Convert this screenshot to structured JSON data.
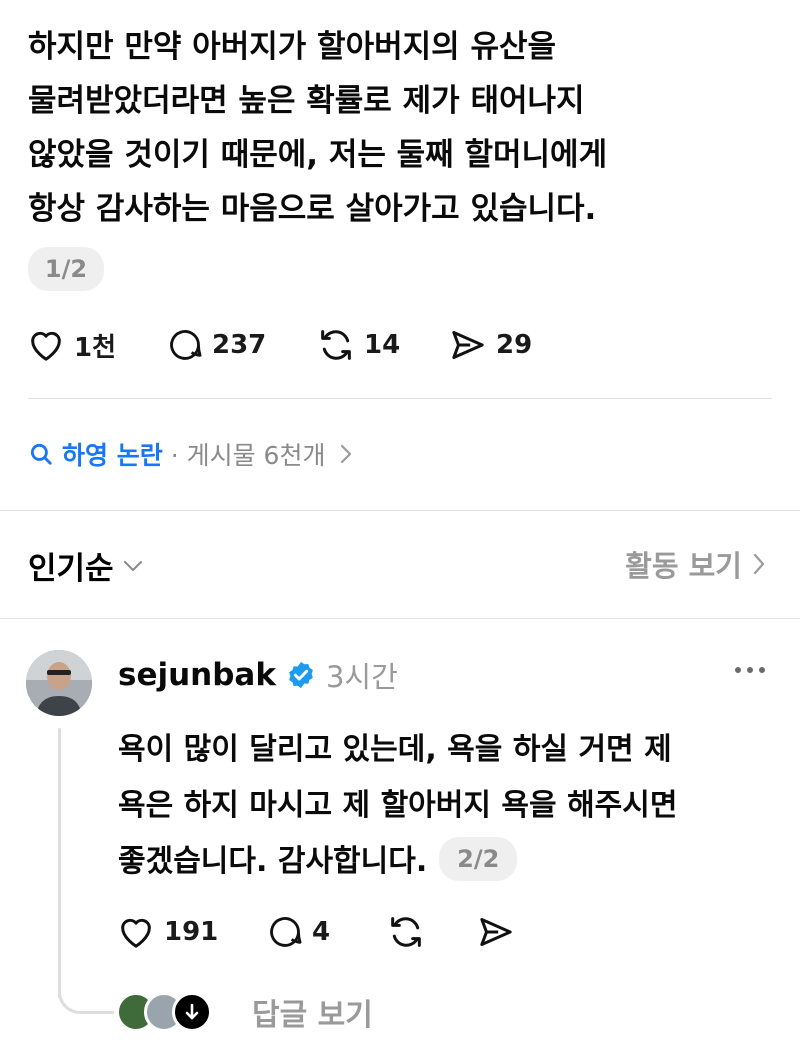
{
  "post": {
    "lines": [
      "하지만 만약 아버지가 할아버지의 유산을",
      "물려받았더라면 높은 확률로 제가 태어나지",
      "않았을 것이기 때문에, 저는 둘째 할머니에게",
      "항상 감사하는 마음으로 살아가고 있습니다."
    ],
    "pager": "1/2",
    "actions": {
      "likes": "1천",
      "replies": "237",
      "reposts": "14",
      "shares": "29"
    }
  },
  "topic": {
    "name": "하영 논란",
    "count": "· 게시물 6천개"
  },
  "sort": {
    "label": "인기순"
  },
  "activity": {
    "label": "활동 보기"
  },
  "reply": {
    "username": "sejunbak",
    "time": "3시간",
    "lines": [
      "욕이 많이 달리고 있는데, 욕을 하실 거면 제",
      "욕은 하지 마시고 제 할아버지 욕을 해주시면",
      "좋겠습니다. 감사합니다."
    ],
    "pager": "2/2",
    "actions": {
      "likes": "191",
      "replies": "4"
    },
    "view_replies": "답글 보기"
  },
  "colors": {
    "accent": "#1877f2",
    "verified": "#1d9bf0",
    "muted": "#9a9a9a"
  },
  "icons": [
    "heart-icon",
    "comment-icon",
    "repost-icon",
    "share-icon",
    "search-icon",
    "chevron-right-icon",
    "chevron-down-icon",
    "verified-badge-icon",
    "more-icon",
    "arrow-down-icon"
  ]
}
